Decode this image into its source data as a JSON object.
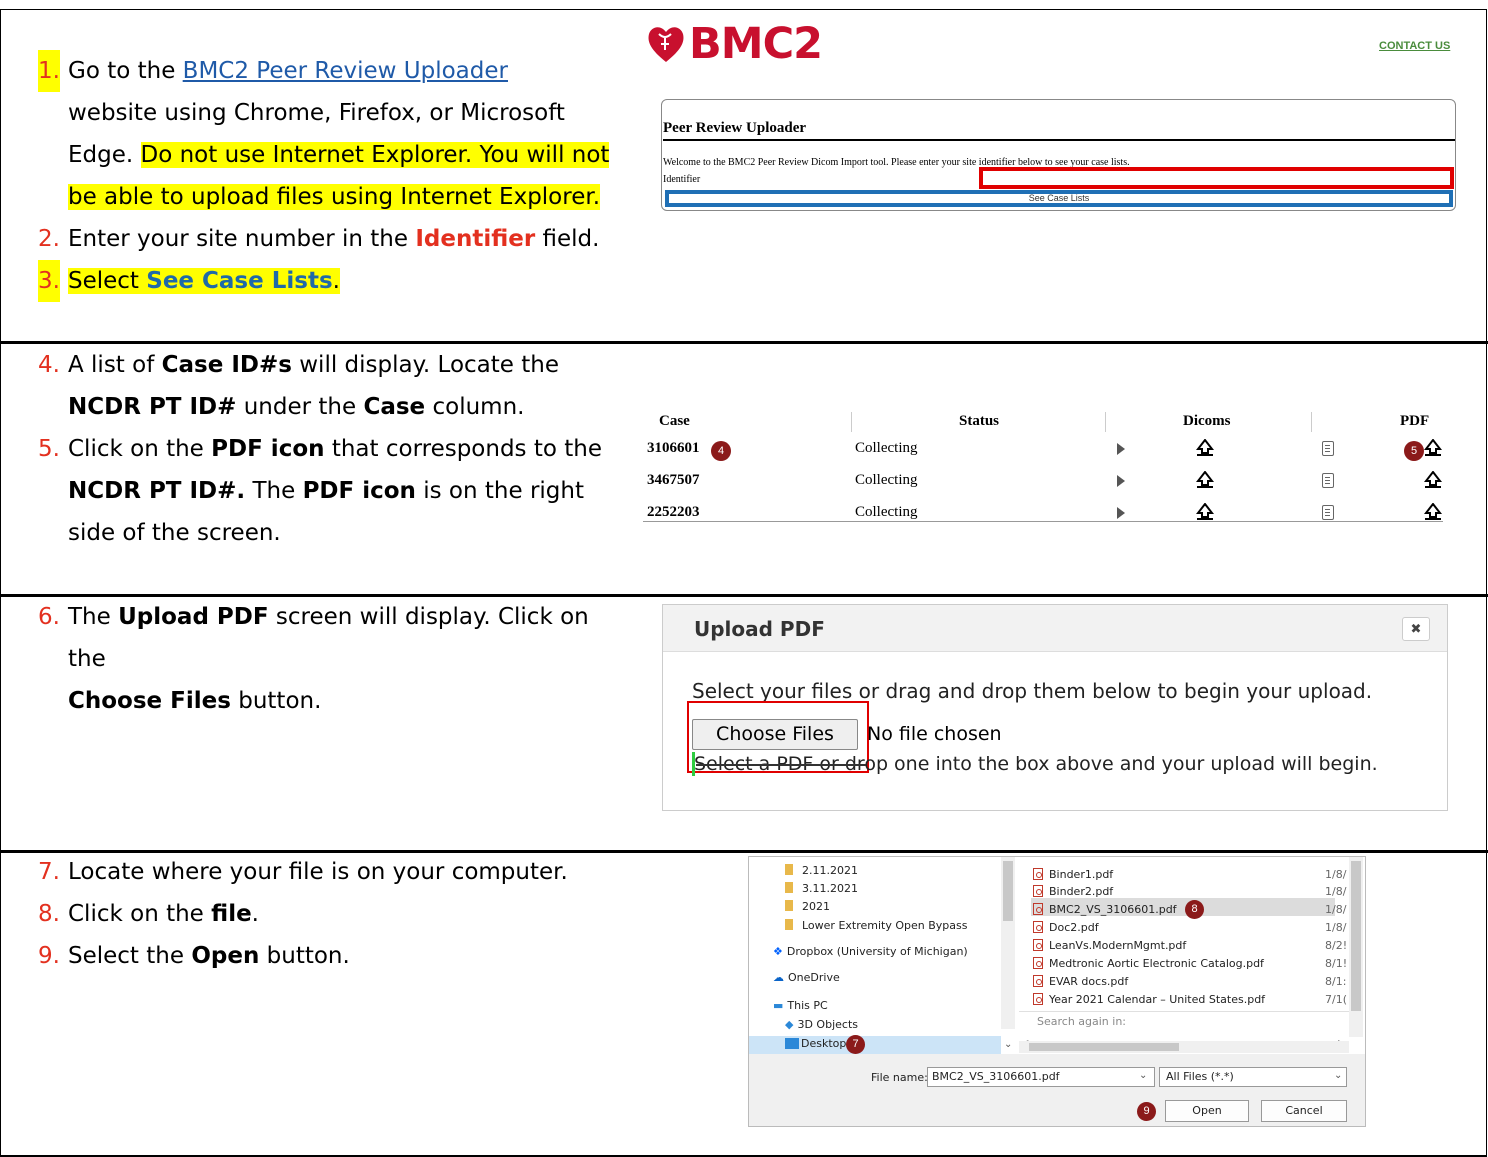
{
  "steps": {
    "s1": {
      "num": "1.",
      "pre": "Go to the ",
      "link": "BMC2 Peer Review Uploader",
      "mid": "website using Chrome, Firefox, or Microsoft Edge. ",
      "hl": "Do not use Internet Explorer. You will not be able to upload files using Internet Explorer."
    },
    "s2": {
      "num": "2.",
      "pre": "Enter your site number in the ",
      "bold": "Identifier",
      "post": " field."
    },
    "s3": {
      "num": "3.",
      "pre": "Select ",
      "bold": "See Case Lists",
      "post": "."
    },
    "s4": {
      "num": "4.",
      "a": "A list of ",
      "b1": "Case ID#s",
      "c": " will display. Locate the ",
      "b2": "NCDR PT ID#",
      "d": " under the ",
      "b3": "Case",
      "e": " column."
    },
    "s5": {
      "num": "5.",
      "a": "Click on the ",
      "b1": "PDF icon",
      "c": " that corresponds to the ",
      "b2": "NCDR PT ID#.",
      "d": " The ",
      "b3": "PDF icon",
      "e": " is on the right side of the screen."
    },
    "s6": {
      "num": "6.",
      "a": "The ",
      "b1": "Upload PDF",
      "c": " screen will display. Click on the ",
      "b2": "Choose Files",
      "d": " button."
    },
    "s7": {
      "num": "7.",
      "text": "Locate where your file is on your computer."
    },
    "s8": {
      "num": "8.",
      "pre": "Click on the ",
      "bold": "file",
      "post": "."
    },
    "s9": {
      "num": "9.",
      "pre": "Select the ",
      "bold": "Open",
      "post": " button."
    }
  },
  "uploader": {
    "logo_text": "BMC2",
    "contact": "CONTACT US",
    "title": "Peer Review Uploader",
    "welcome": "Welcome to the BMC2 Peer Review Dicom Import tool. Please enter your site identifier below to see your case lists.",
    "identifier_label": "Identifier",
    "button": "See Case Lists"
  },
  "case_table": {
    "headers": [
      "Case",
      "Status",
      "Dicoms",
      "PDF"
    ],
    "rows": [
      {
        "case": "3106601",
        "status": "Collecting"
      },
      {
        "case": "3467507",
        "status": "Collecting"
      },
      {
        "case": "2252203",
        "status": "Collecting"
      }
    ],
    "badge_case": "4",
    "badge_pdf": "5"
  },
  "upload_pdf": {
    "title": "Upload PDF",
    "close": "✖",
    "description": "Select your files or drag and drop them below to begin your upload.",
    "choose": "Choose Files",
    "no_file": "No file chosen",
    "hint": "Select a PDF or drop one into the box above and your upload will begin."
  },
  "file_dialog": {
    "folders": [
      "2.11.2021",
      "3.11.2021",
      "2021",
      "Lower Extremity Open Bypass"
    ],
    "dropbox": "Dropbox (University of Michigan)",
    "onedrive": "OneDrive",
    "thispc": "This PC",
    "objects": "3D Objects",
    "desktop": "Desktop",
    "desktop_badge": "7",
    "files": [
      {
        "name": "Binder1.pdf",
        "date": "1/8/"
      },
      {
        "name": "Binder2.pdf",
        "date": "1/8/"
      },
      {
        "name": "BMC2_VS_3106601.pdf",
        "date": "1/8/"
      },
      {
        "name": "Doc2.pdf",
        "date": "1/8/"
      },
      {
        "name": "LeanVs.ModernMgmt.pdf",
        "date": "8/2!"
      },
      {
        "name": "Medtronic Aortic Electronic Catalog.pdf",
        "date": "8/1!"
      },
      {
        "name": "EVAR docs.pdf",
        "date": "8/1:"
      },
      {
        "name": "Year 2021 Calendar – United States.pdf",
        "date": "7/1("
      }
    ],
    "file_badge": "8",
    "search_again": "Search again in:",
    "file_name_label": "File name:",
    "file_name": "BMC2_VS_3106601.pdf",
    "filter": "All Files (*.*)",
    "open": "Open",
    "cancel": "Cancel",
    "open_badge": "9"
  }
}
